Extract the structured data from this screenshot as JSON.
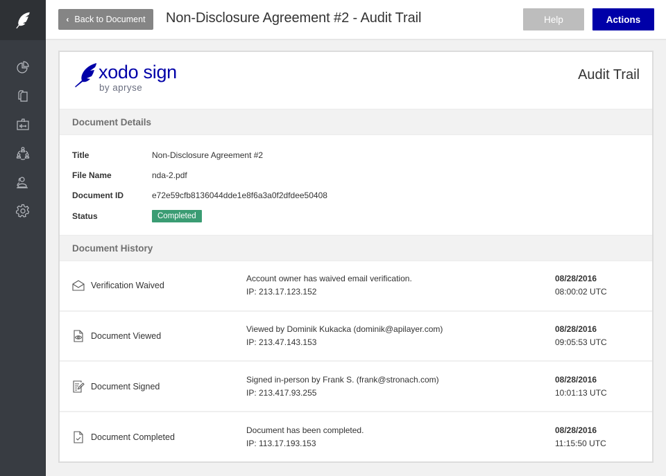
{
  "sidebar": {
    "brand_icon": "feather-icon",
    "items": [
      {
        "name": "dashboard",
        "icon": "pie-chart-icon"
      },
      {
        "name": "documents",
        "icon": "documents-icon"
      },
      {
        "name": "templates",
        "icon": "template-icon"
      },
      {
        "name": "team",
        "icon": "team-icon"
      },
      {
        "name": "contacts",
        "icon": "contacts-icon"
      },
      {
        "name": "settings",
        "icon": "gear-icon"
      }
    ]
  },
  "header": {
    "back_label": "Back to Document",
    "title": "Non-Disclosure Agreement #2 - Audit Trail",
    "help_label": "Help",
    "actions_label": "Actions"
  },
  "card": {
    "logo_name": "xodo sign",
    "logo_by": "by apryse",
    "doc_type": "Audit Trail",
    "details_header": "Document Details",
    "details": [
      {
        "label": "Title",
        "value": "Non-Disclosure Agreement #2"
      },
      {
        "label": "File Name",
        "value": "nda-2.pdf"
      },
      {
        "label": "Document ID",
        "value": "e72e59cfb8136044dde1e8f6a3a0f2dfdee50408"
      }
    ],
    "status": {
      "label": "Status",
      "value": "Completed",
      "color": "#3a9c73"
    },
    "history_header": "Document History",
    "history": [
      {
        "icon": "envelope-open-icon",
        "event": "Verification Waived",
        "description": "Account owner has waived email verification.",
        "ip": "IP: 213.17.123.152",
        "date": "08/28/2016",
        "time": "08:00:02 UTC"
      },
      {
        "icon": "document-eye-icon",
        "event": "Document Viewed",
        "description": "Viewed by Dominik Kukacka (dominik@apilayer.com)",
        "ip": "IP: 213.47.143.153",
        "date": "08/28/2016",
        "time": "09:05:53 UTC"
      },
      {
        "icon": "document-signed-icon",
        "event": "Document Signed",
        "description": "Signed in-person by Frank S. (frank@stronach.com)",
        "ip": "IP: 213.417.93.255",
        "date": "08/28/2016",
        "time": "10:01:13 UTC"
      },
      {
        "icon": "document-check-icon",
        "event": "Document Completed",
        "description": "Document has been completed.",
        "ip": "IP: 113.17.193.153",
        "date": "08/28/2016",
        "time": "11:15:50 UTC"
      }
    ]
  },
  "colors": {
    "brand": "#0000a8",
    "sidebar": "#383c42",
    "success": "#3a9c73"
  }
}
